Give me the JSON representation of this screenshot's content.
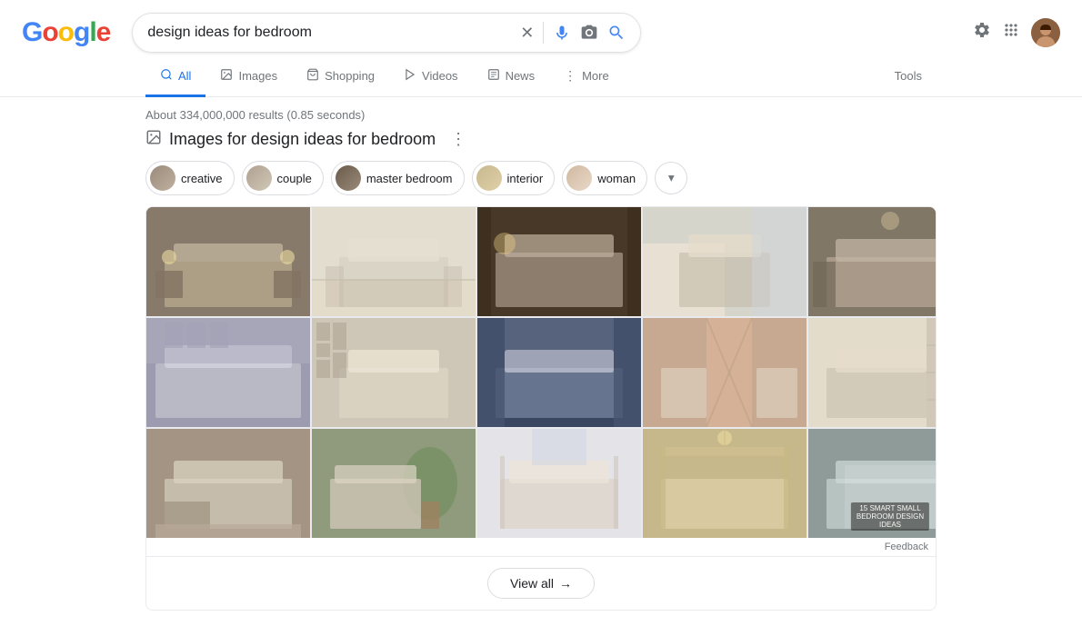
{
  "logo": {
    "letters": [
      "G",
      "o",
      "o",
      "g",
      "l",
      "e"
    ]
  },
  "search": {
    "value": "design ideas for bedroom",
    "placeholder": "Search"
  },
  "nav": {
    "tabs": [
      {
        "id": "all",
        "label": "All",
        "icon": "🔍",
        "active": true
      },
      {
        "id": "images",
        "label": "Images",
        "icon": "🖼"
      },
      {
        "id": "shopping",
        "label": "Shopping",
        "icon": "🛍"
      },
      {
        "id": "videos",
        "label": "Videos",
        "icon": "▶"
      },
      {
        "id": "news",
        "label": "News",
        "icon": "📄"
      },
      {
        "id": "more",
        "label": "More",
        "icon": "⋮"
      }
    ],
    "tools": "Tools"
  },
  "results": {
    "count_text": "About 334,000,000 results (0.85 seconds)"
  },
  "images_section": {
    "title": "Images for design ideas for bedroom",
    "chips": [
      {
        "label": "creative"
      },
      {
        "label": "couple"
      },
      {
        "label": "master bedroom"
      },
      {
        "label": "interior"
      },
      {
        "label": "woman"
      }
    ]
  },
  "feedback": {
    "label": "Feedback"
  },
  "view_all": {
    "label": "View all",
    "arrow": "→"
  }
}
